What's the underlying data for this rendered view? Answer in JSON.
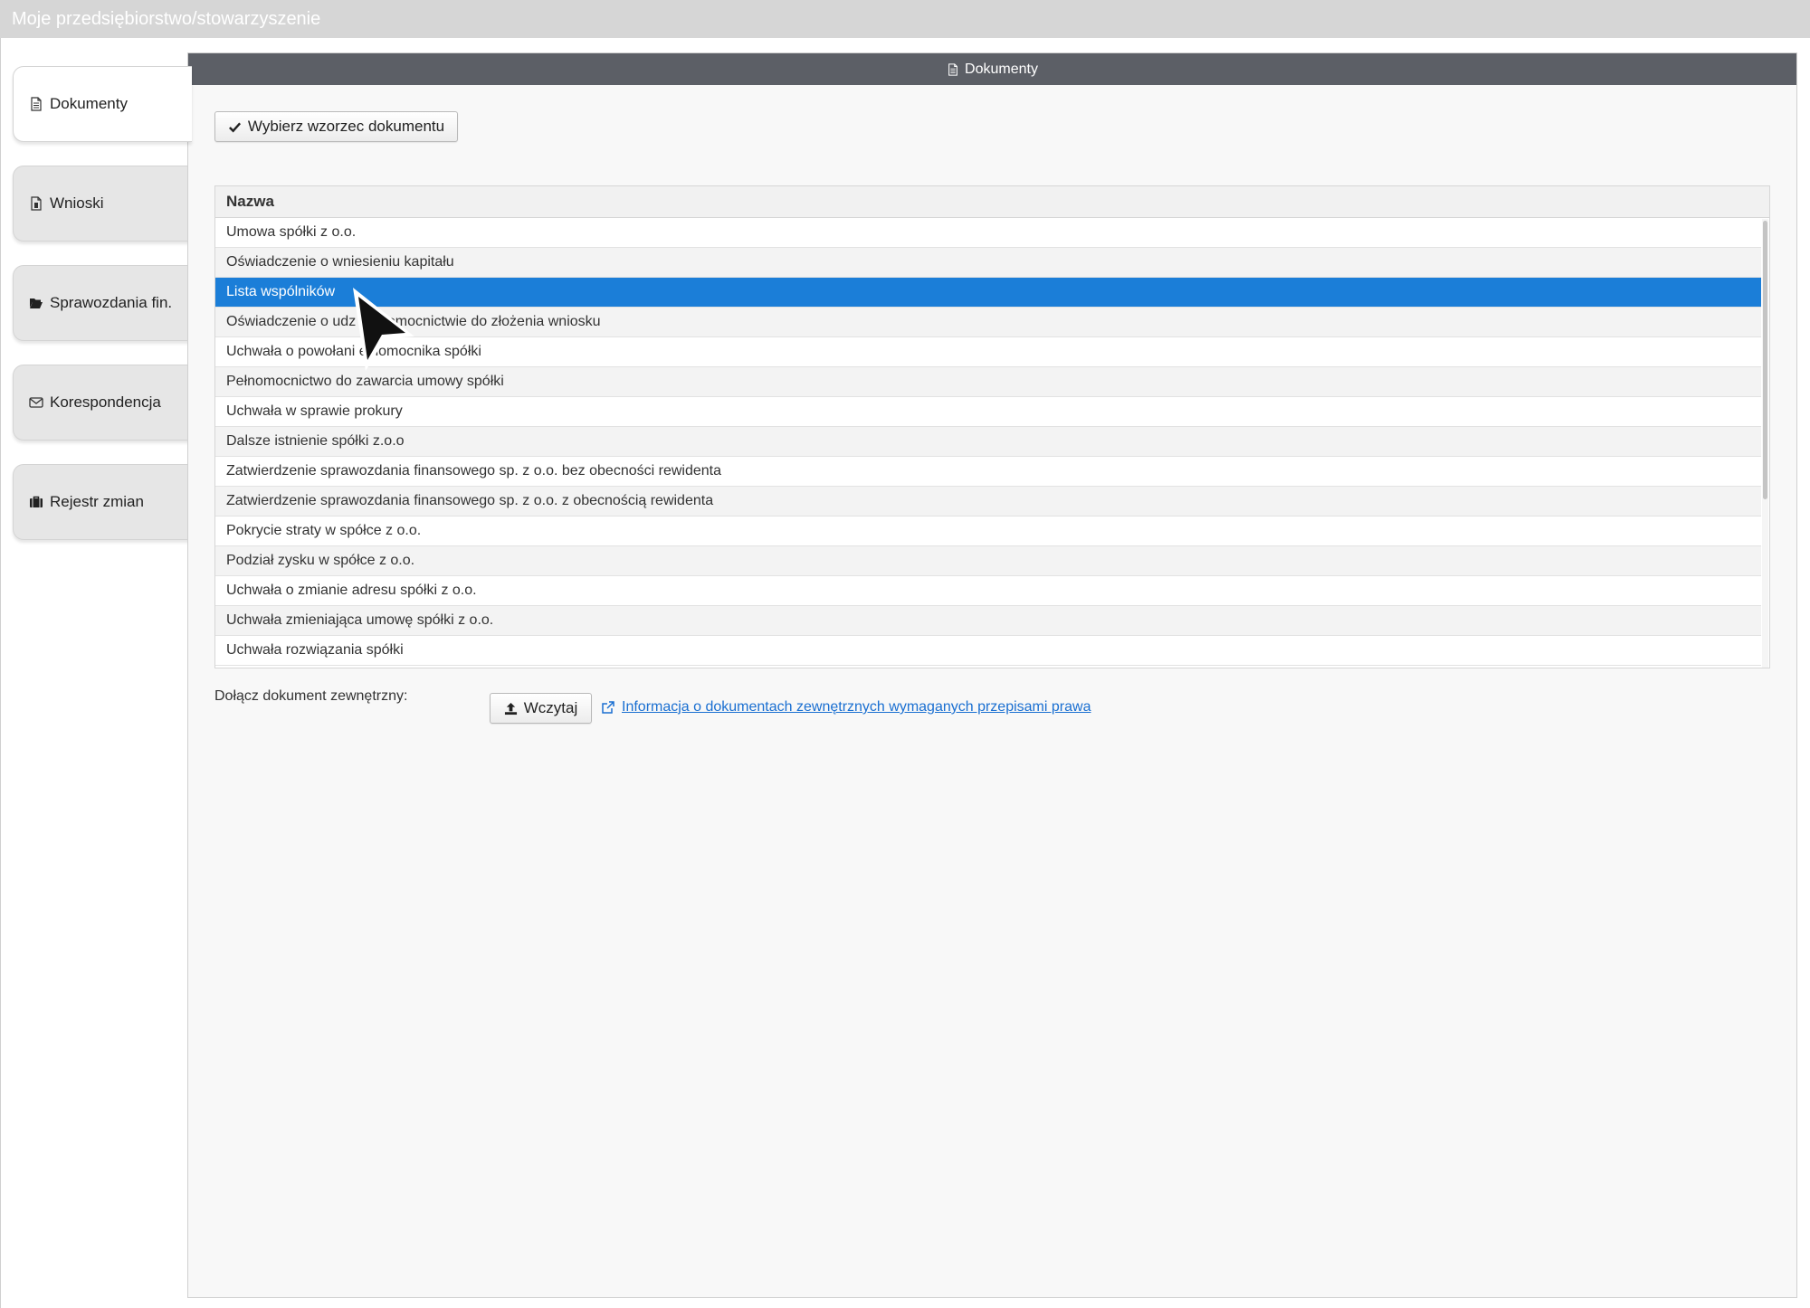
{
  "window": {
    "title": "Moje przedsiębiorstwo/stowarzyszenie"
  },
  "sidebar": {
    "items": [
      {
        "label": "Dokumenty",
        "icon": "document-icon",
        "active": true
      },
      {
        "label": "Wnioski",
        "icon": "request-document-icon",
        "active": false
      },
      {
        "label": "Sprawozdania fin.",
        "icon": "folder-open-icon",
        "active": false
      },
      {
        "label": "Korespondencja",
        "icon": "envelope-icon",
        "active": false
      },
      {
        "label": "Rejestr zmian",
        "icon": "briefcase-icon",
        "active": false
      }
    ]
  },
  "panel": {
    "title": "Dokumenty",
    "choose_template_label": "Wybierz wzorzec dokumentu",
    "table": {
      "column_header": "Nazwa",
      "selected_index": 2,
      "rows": [
        "Umowa spółki z o.o.",
        "Oświadczenie o wniesieniu kapitału",
        "Lista wspólników",
        "Oświadczenie o udz pełnomocnictwie do złożenia wniosku",
        "Uchwała o powołani ełnomocnika spółki",
        "Pełnomocnictwo do zawarcia umowy spółki",
        "Uchwała w sprawie prokury",
        "Dalsze istnienie spółki z.o.o",
        "Zatwierdzenie sprawozdania finansowego sp. z o.o. bez obecności rewidenta",
        "Zatwierdzenie sprawozdania finansowego sp. z o.o. z obecnością rewidenta",
        "Pokrycie straty w spółce z o.o.",
        "Podział zysku w spółce z o.o.",
        "Uchwała o zmianie adresu spółki z o.o.",
        "Uchwała zmieniająca umowę spółki z o.o.",
        "Uchwała rozwiązania spółki"
      ]
    },
    "attach_label": "Dołącz dokument zewnętrzny:",
    "load_button_label": "Wczytaj",
    "info_link_label": "Informacja o dokumentach zewnętrznych wymaganych przepisami prawa"
  },
  "colors": {
    "selection": "#1b7ed8",
    "header": "#5c5f66",
    "link": "#1a6fd1"
  }
}
